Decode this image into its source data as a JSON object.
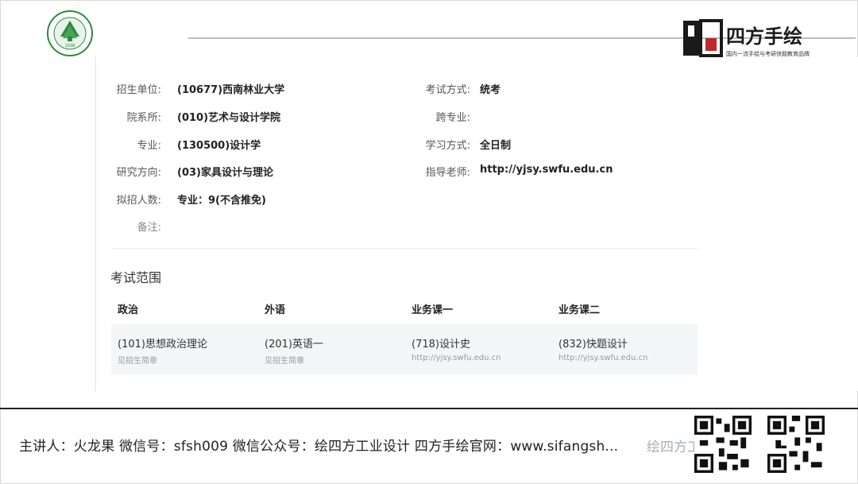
{
  "brand": {
    "name": "四方手绘",
    "slogan": "国内一流手绘与考研快题教育品牌",
    "school_logo_year": "1938"
  },
  "info": {
    "left": [
      {
        "label": "招生单位:",
        "value": "(10677)西南林业大学"
      },
      {
        "label": "院系所:",
        "value": "(010)艺术与设计学院"
      },
      {
        "label": "专业:",
        "value": "(130500)设计学"
      },
      {
        "label": "研究方向:",
        "value": "(03)家具设计与理论"
      },
      {
        "label": "拟招人数:",
        "value": "专业：9(不含推免)"
      },
      {
        "label": "备注:",
        "value": ""
      }
    ],
    "right": [
      {
        "label": "考试方式:",
        "value": "统考"
      },
      {
        "label": "跨专业:",
        "value": ""
      },
      {
        "label": "学习方式:",
        "value": "全日制"
      },
      {
        "label": "指导老师:",
        "value": "http://yjsy.swfu.edu.cn"
      }
    ]
  },
  "exam": {
    "title": "考试范围",
    "columns": [
      {
        "header": "政治",
        "main": "(101)思想政治理论",
        "sub": "见招生简章"
      },
      {
        "header": "外语",
        "main": "(201)英语一",
        "sub": "见招生简章"
      },
      {
        "header": "业务课一",
        "main": "(718)设计史",
        "sub": "http://yjsy.swfu.edu.cn"
      },
      {
        "header": "业务课二",
        "main": "(832)快题设计",
        "sub": "http://yjsy.swfu.edu.cn"
      }
    ]
  },
  "footer": {
    "text": "主讲人：火龙果   微信号：sfsh009   微信公众号：绘四方工业设计   四方手绘官网：www.sifangsh...",
    "watermark": "绘四方工业设计"
  },
  "colors": {
    "brand_red": "#c0272d",
    "logo_green": "#2e8b3a",
    "text_dark": "#222222"
  }
}
